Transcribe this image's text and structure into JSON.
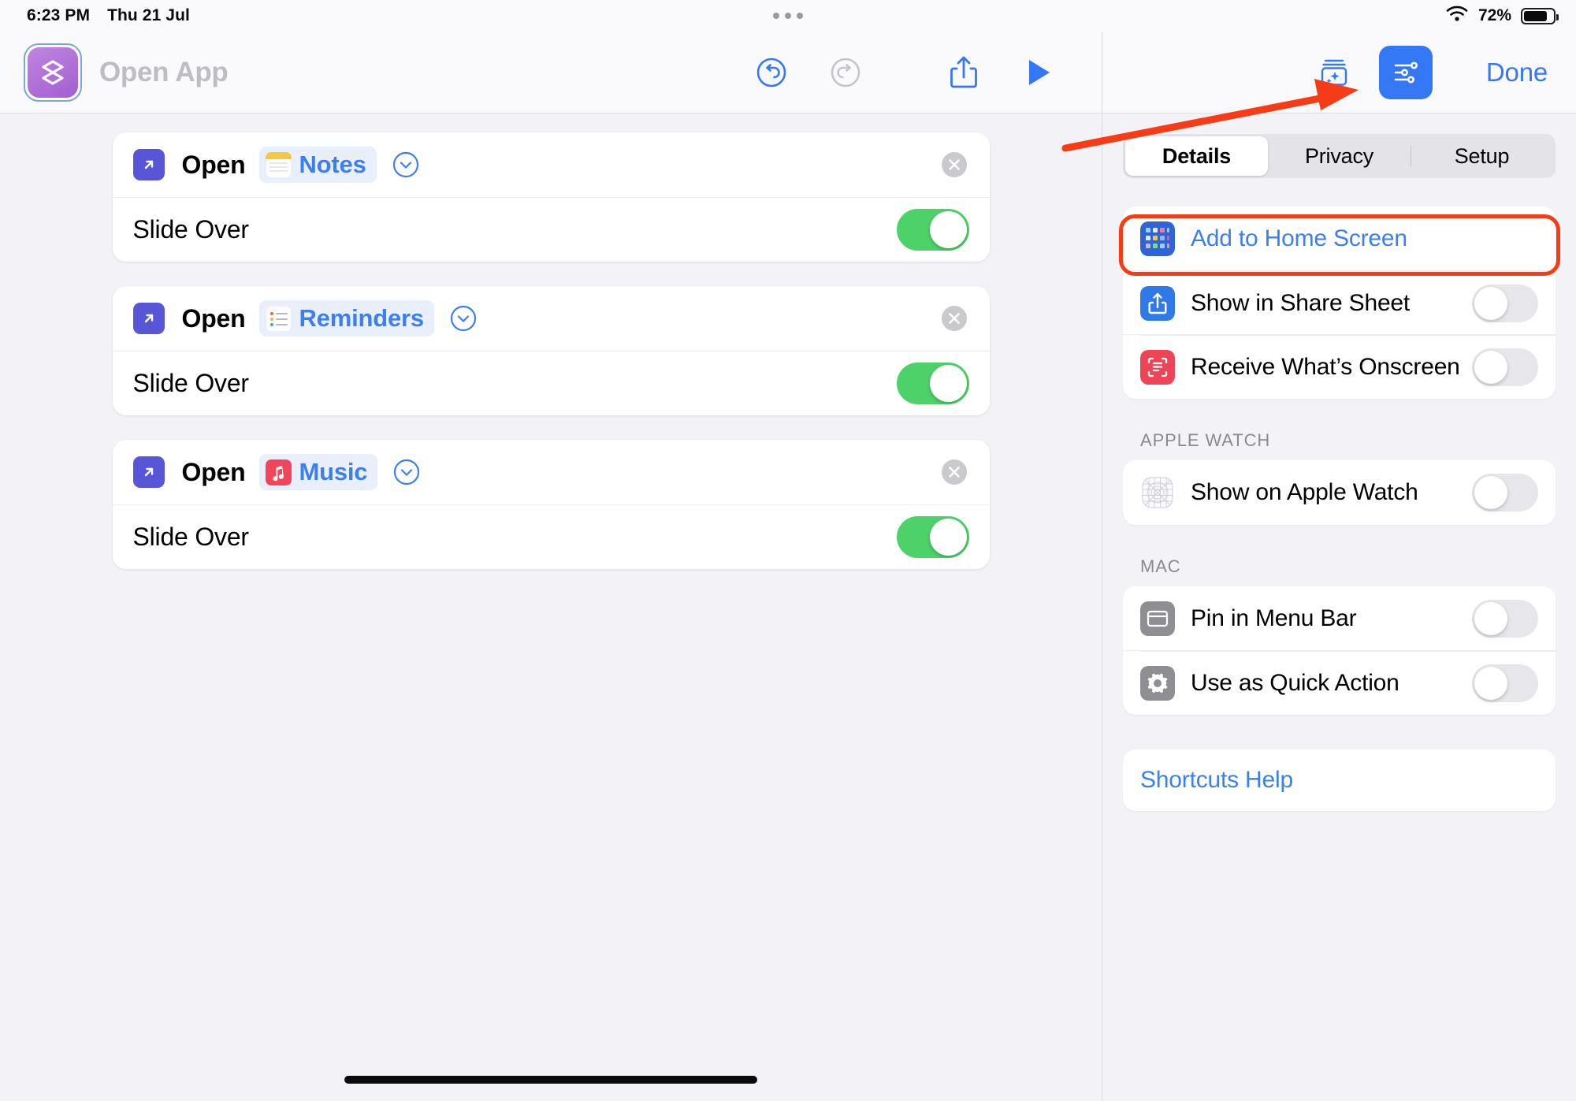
{
  "status_bar": {
    "time": "6:23 PM",
    "date": "Thu 21 Jul",
    "battery_percent": "72%",
    "wifi_icon": "wifi-icon",
    "battery_icon": "battery-icon",
    "menu_dots_icon": "multitasking-dots-icon"
  },
  "left_pane": {
    "shortcut_icon": "layers-stack-icon",
    "title": "Open App",
    "toolbar": {
      "undo_icon": "undo-circle-icon",
      "redo_icon": "redo-circle-icon",
      "share_icon": "share-icon",
      "play_icon": "play-icon"
    },
    "cards": [
      {
        "action_icon": "open-app-arrow-icon",
        "verb": "Open",
        "app_icon": "notes-app-icon",
        "app_name": "Notes",
        "chevron_icon": "chevron-down-circle-icon",
        "close_icon": "close-circle-icon",
        "option_label": "Slide Over",
        "option_state": "on"
      },
      {
        "action_icon": "open-app-arrow-icon",
        "verb": "Open",
        "app_icon": "reminders-app-icon",
        "app_name": "Reminders",
        "chevron_icon": "chevron-down-circle-icon",
        "close_icon": "close-circle-icon",
        "option_label": "Slide Over",
        "option_state": "on"
      },
      {
        "action_icon": "open-app-arrow-icon",
        "verb": "Open",
        "app_icon": "music-app-icon",
        "app_name": "Music",
        "chevron_icon": "chevron-down-circle-icon",
        "close_icon": "close-circle-icon",
        "option_label": "Slide Over",
        "option_state": "on"
      }
    ]
  },
  "right_pane": {
    "toolbar": {
      "add_action_icon": "add-action-sparkle-icon",
      "settings_icon": "sliders-settings-icon",
      "done_label": "Done"
    },
    "tabs": [
      {
        "label": "Details",
        "selected": true
      },
      {
        "label": "Privacy",
        "selected": false
      },
      {
        "label": "Setup",
        "selected": false
      }
    ],
    "sections": [
      {
        "header": "",
        "rows": [
          {
            "label": "Add to Home Screen",
            "icon": "home-screen-grid-icon",
            "type": "link",
            "highlighted": true
          },
          {
            "label": "Show in Share Sheet",
            "icon": "share-sheet-icon",
            "type": "toggle",
            "state": "off"
          },
          {
            "label": "Receive What’s Onscreen",
            "icon": "onscreen-text-icon",
            "type": "toggle",
            "state": "off"
          }
        ]
      },
      {
        "header": "APPLE WATCH",
        "rows": [
          {
            "label": "Show on Apple Watch",
            "icon": "apple-watch-icon",
            "type": "toggle",
            "state": "off"
          }
        ]
      },
      {
        "header": "MAC",
        "rows": [
          {
            "label": "Pin in Menu Bar",
            "icon": "menu-bar-icon",
            "type": "toggle",
            "state": "off"
          },
          {
            "label": "Use as Quick Action",
            "icon": "gear-icon",
            "type": "toggle",
            "state": "off"
          }
        ]
      }
    ],
    "help": {
      "label": "Shortcuts Help"
    }
  },
  "annotations": {
    "arrow_color": "#f63c17",
    "highlight_color": "#f63c17",
    "arrow_icon": "red-pointer-arrow",
    "highlight_icon": "red-highlight-ring"
  },
  "colors": {
    "accent_blue": "#3478f6",
    "link_blue": "#3c7ff0",
    "toggle_green": "#4cd268",
    "bg_gray": "#f2f2f7"
  }
}
